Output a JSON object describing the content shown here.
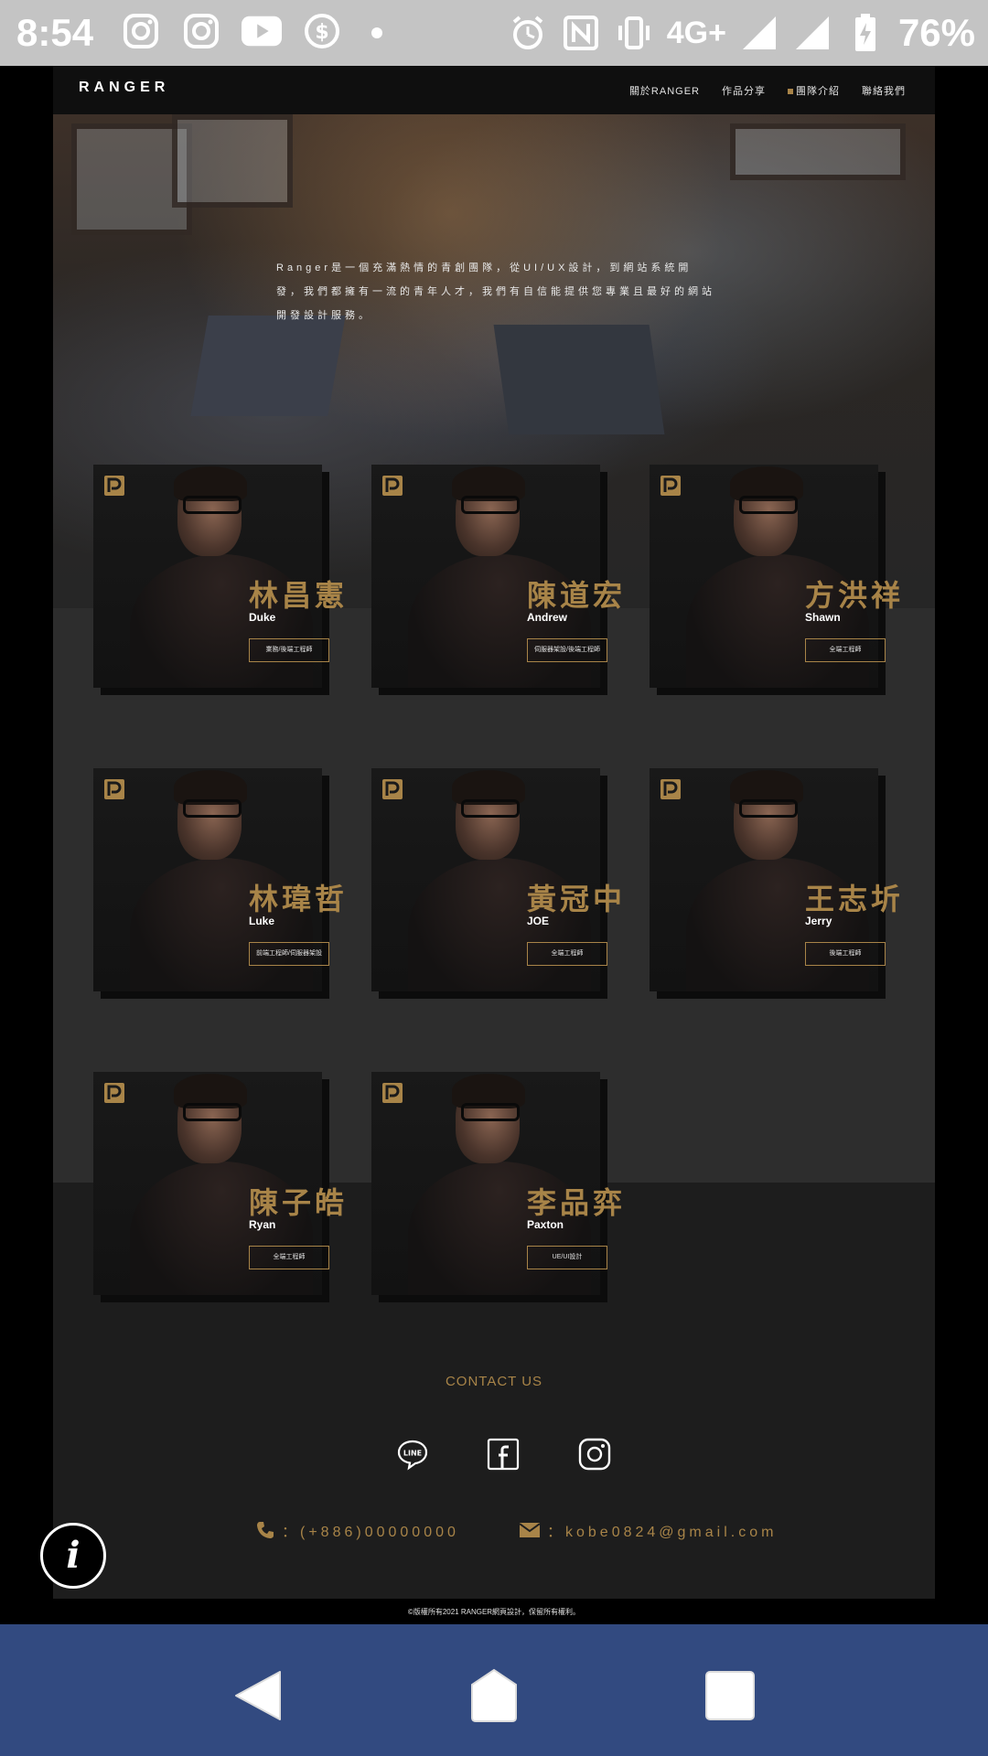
{
  "status_bar": {
    "time": "8:54",
    "network": "4G+",
    "battery": "76%"
  },
  "site": {
    "logo": "RANGER",
    "nav": [
      "關於RANGER",
      "作品分享",
      "團隊介紹",
      "聯絡我們"
    ],
    "hero_text": "Ranger是一個充滿熱情的青創團隊，從UI/UX設計，到網站系統開發，我們都擁有一流的青年人才，我們有自信能提供您專業且最好的網站開發設計服務。",
    "members": [
      {
        "cn": "林昌憲",
        "en": "Duke",
        "role": "業務/後端工程師"
      },
      {
        "cn": "陳道宏",
        "en": "Andrew",
        "role": "伺服器架設/後端工程師"
      },
      {
        "cn": "方洪祥",
        "en": "Shawn",
        "role": "全端工程師"
      },
      {
        "cn": "林瑋哲",
        "en": "Luke",
        "role": "前端工程師/伺服器架設"
      },
      {
        "cn": "黃冠中",
        "en": "JOE",
        "role": "全端工程師"
      },
      {
        "cn": "王志圻",
        "en": "Jerry",
        "role": "後端工程師"
      },
      {
        "cn": "陳子皓",
        "en": "Ryan",
        "role": "全端工程師"
      },
      {
        "cn": "李品弈",
        "en": "Paxton",
        "role": "UE/UI設計"
      }
    ],
    "contact_title": "CONTACT US",
    "phone": "：(+886)00000000",
    "email": "：kobe0824@gmail.com",
    "copyright": "©版權所有2021 RANGER網頁設計，保留所有權利。"
  },
  "accent_color": "#a88448"
}
